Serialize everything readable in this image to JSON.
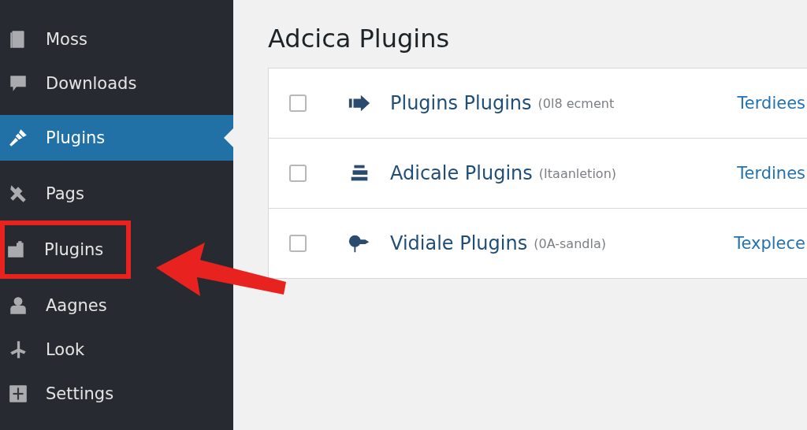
{
  "sidebar": {
    "items": [
      {
        "label": "Moss",
        "selected": false,
        "highlighted": false
      },
      {
        "label": "Downloads",
        "selected": false,
        "highlighted": false
      },
      {
        "label": "Plugins",
        "selected": true,
        "highlighted": false
      },
      {
        "label": "Pags",
        "selected": false,
        "highlighted": false
      },
      {
        "label": "Plugins",
        "selected": false,
        "highlighted": true
      },
      {
        "label": "Aagnes",
        "selected": false,
        "highlighted": false
      },
      {
        "label": "Look",
        "selected": false,
        "highlighted": false
      },
      {
        "label": "Settings",
        "selected": false,
        "highlighted": false
      }
    ]
  },
  "page": {
    "title": "Adcica Plugins"
  },
  "plugins": [
    {
      "name": "Plugins Plugins",
      "description": "(0l8 ecment",
      "action": "Terdiees",
      "checked": false
    },
    {
      "name": "Adicale Plugins",
      "description": "(Itaanletion)",
      "action": "Terdines",
      "checked": false
    },
    {
      "name": "Vidiale Plugins",
      "description": "(0A-sandla)",
      "action": "Texplece",
      "checked": false
    }
  ]
}
